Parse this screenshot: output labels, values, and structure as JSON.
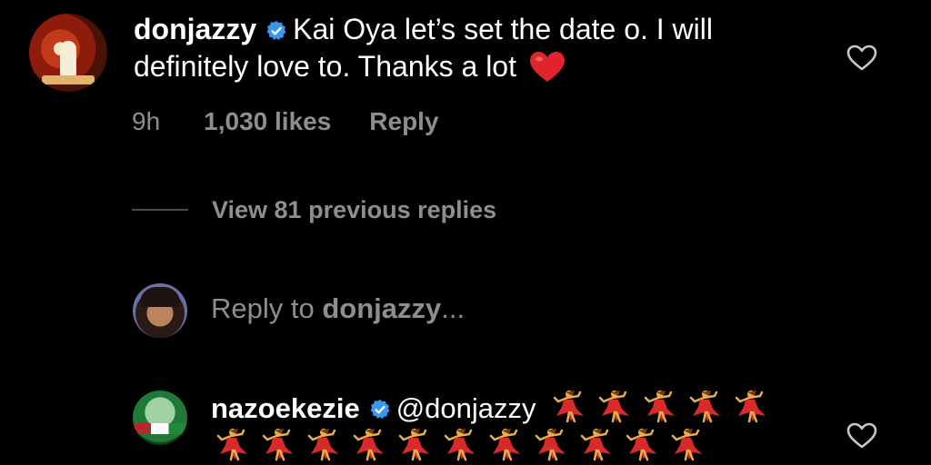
{
  "comment": {
    "username": "donjazzy",
    "text": "Kai Oya let’s set the date o. I will definitely love to. Thanks a lot",
    "emoji": "red-heart",
    "time": "9h",
    "likes": "1,030 likes",
    "reply_label": "Reply"
  },
  "view_replies": {
    "label": "View 81 previous replies"
  },
  "reply_input": {
    "prefix": "Reply to ",
    "target": "donjazzy",
    "suffix": "..."
  },
  "reply": {
    "username": "nazoekezie",
    "mention": "@donjazzy",
    "emoji": "dancer",
    "emoji_count": 16
  },
  "colors": {
    "background": "#000000",
    "muted": "#8e8e8e",
    "verified": "#3897f0",
    "heart": "#e0242b"
  },
  "icons": [
    "verified-badge-icon",
    "heart-emoji-icon",
    "like-heart-icon",
    "dancer-emoji-icon"
  ]
}
